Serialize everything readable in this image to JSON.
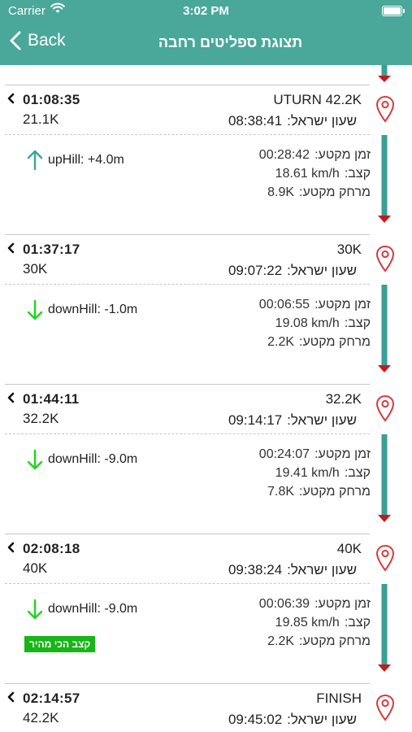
{
  "status": {
    "carrier": "Carrier",
    "time": "3:02 PM"
  },
  "nav": {
    "back_label": "Back",
    "title": "תצוגת ספליטים רחבה"
  },
  "labels": {
    "clock_prefix": "שעון ישראל:",
    "segment_time": "זמן מקטע:",
    "pace": "קצב:",
    "segment_distance": "מרחק מקטע:"
  },
  "checkpoints": [
    {
      "name": "UTURN 42.2K",
      "clock": "08:38:41",
      "cum_time": "01:08:35",
      "cum_dist": "21.1K"
    },
    {
      "name": "30K",
      "clock": "09:07:22",
      "cum_time": "01:37:17",
      "cum_dist": "30K"
    },
    {
      "name": "32.2K",
      "clock": "09:14:17",
      "cum_time": "01:44:11",
      "cum_dist": "32.2K"
    },
    {
      "name": "40K",
      "clock": "09:38:24",
      "cum_time": "02:08:18",
      "cum_dist": "40K"
    },
    {
      "name": "FINISH",
      "clock": "09:45:02",
      "cum_time": "02:14:57",
      "cum_dist": "42.2K"
    }
  ],
  "segments": [
    {
      "time": "00:28:42",
      "pace": "18.61 km/h",
      "distance": "8.9K",
      "elevation": "upHill: +4.0m",
      "direction": "up",
      "badge": ""
    },
    {
      "time": "00:06:55",
      "pace": "19.08 km/h",
      "distance": "2.2K",
      "elevation": "downHill: -1.0m",
      "direction": "down",
      "badge": ""
    },
    {
      "time": "00:24:07",
      "pace": "19.41 km/h",
      "distance": "7.8K",
      "elevation": "downHill: -9.0m",
      "direction": "down",
      "badge": ""
    },
    {
      "time": "00:06:39",
      "pace": "19.85 km/h",
      "distance": "2.2K",
      "elevation": "downHill: -9.0m",
      "direction": "down",
      "badge": "קצב הכי מהיר"
    }
  ],
  "colors": {
    "brand": "#4aa89a",
    "bar": "#3a9f96",
    "bar_arrow": "#c6191c",
    "pin": "#d9393d",
    "up_arrow": "#3aa597",
    "down_arrow": "#1fd41f",
    "fastest_badge": "#18b518"
  },
  "icons": {
    "back": "chevron-left-icon",
    "pin": "location-pin-icon",
    "expand": "chevron-left-icon",
    "up": "arrow-up-icon",
    "down": "arrow-down-icon"
  }
}
